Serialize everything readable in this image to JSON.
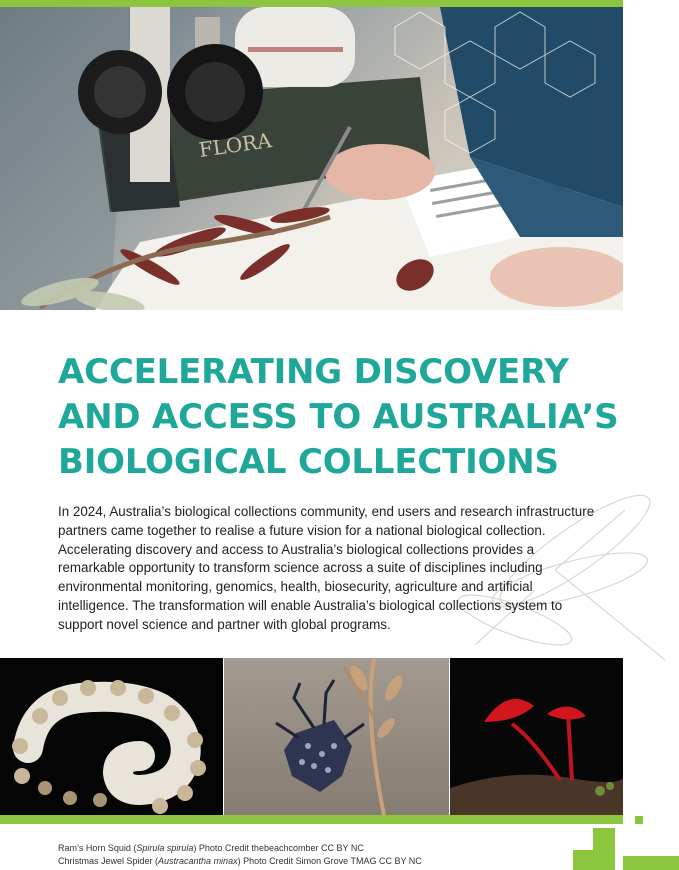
{
  "document": {
    "title_lines": [
      "ACCELERATING DISCOVERY",
      "AND ACCESS TO AUSTRALIA’S",
      "BIOLOGICAL COLLECTIONS"
    ],
    "body_lines": [
      "In 2024, Australia’s biological collections community, end users and research infrastructure",
      "partners came together to realise a future vision for a national biological collection.",
      "Accelerating discovery and access to Australia’s biological collections provides a",
      "remarkable opportunity to transform science across a suite of disciplines including",
      "environmental monitoring, genomics, health, biosecurity, agriculture and artificial",
      "intelligence. The transformation will enable Australia’s biological collections system to",
      "support novel science and partner with global programs."
    ],
    "captions": [
      {
        "prefix": "Ram’s Horn Squid (",
        "species": "Spirula spirula",
        "suffix": ") Photo Credit thebeachcomber CC BY NC"
      },
      {
        "prefix": "Christmas Jewel Spider (",
        "species": "Austracantha minax",
        "suffix": ") Photo Credit Simon Grove TMAG CC BY NC"
      }
    ],
    "hero_book_spine_text": "FLORA"
  },
  "colors": {
    "accent_green": "#8cc63f",
    "title_teal": "#1fa89a",
    "body_text": "#222222"
  }
}
